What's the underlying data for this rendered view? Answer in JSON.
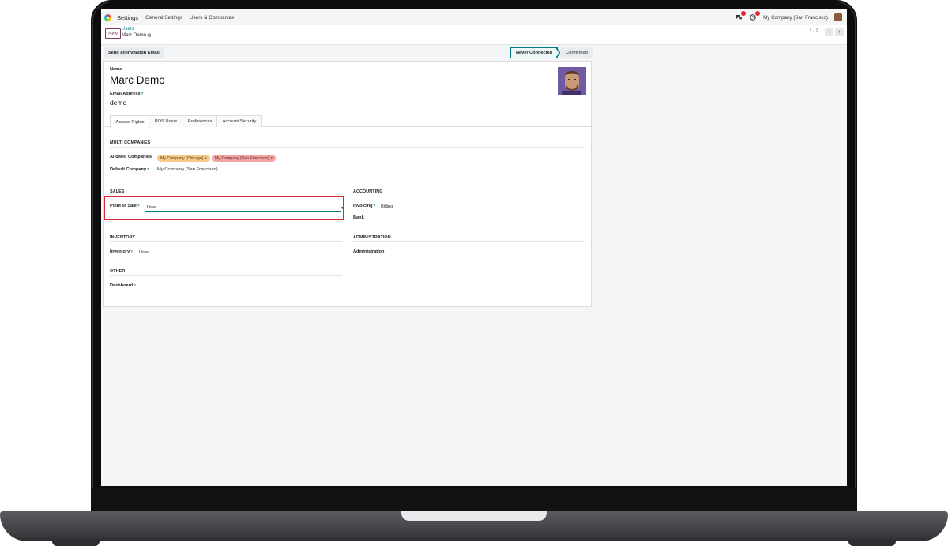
{
  "navbar": {
    "app_name": "Settings",
    "menu": [
      "General Settings",
      "Users & Companies"
    ],
    "company": "My Company (San Francisco)"
  },
  "control": {
    "new_label": "New",
    "breadcrumb_parent": "Users",
    "breadcrumb_current": "Marc Demo",
    "pager": "1 / 2"
  },
  "statusbar": {
    "invite_label": "Send an Invitation Email",
    "states": [
      "Never Connected",
      "Confirmed"
    ]
  },
  "form": {
    "name_label": "Name",
    "name_value": "Marc Demo",
    "email_label": "Email Address",
    "email_value": "demo",
    "tabs": [
      "Access Rights",
      "POS Users",
      "Preferences",
      "Account Security"
    ],
    "multi_companies": {
      "title": "MULTI COMPANIES",
      "allowed_label": "Allowed Companies",
      "allowed": [
        "My Company (Chicago)",
        "My Company (San Francisco)"
      ],
      "default_label": "Default Company",
      "default_value": "My Company (San Francisco)"
    },
    "sales": {
      "title": "SALES",
      "pos_label": "Point of Sale",
      "pos_value": "User"
    },
    "accounting": {
      "title": "ACCOUNTING",
      "invoicing_label": "Invoicing",
      "invoicing_value": "Billing",
      "bank_label": "Bank"
    },
    "inventory": {
      "title": "INVENTORY",
      "inventory_label": "Inventory",
      "inventory_value": "User"
    },
    "administration": {
      "title": "ADMINISTRATION",
      "admin_label": "Administration"
    },
    "other": {
      "title": "OTHER",
      "dashboard_label": "Dashboard"
    }
  },
  "colors": {
    "accent": "#017e84",
    "brand": "#7c3a5e",
    "highlight": "#e0262e"
  }
}
